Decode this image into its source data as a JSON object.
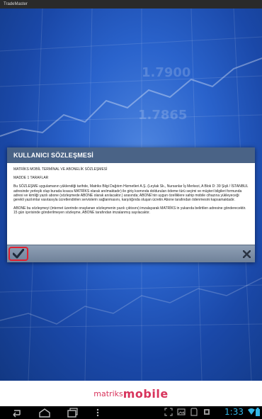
{
  "app": {
    "title": "TradeMaster"
  },
  "background": {
    "numbers": [
      "1.7900",
      "1.7865"
    ]
  },
  "dialog": {
    "title": "KULLANICI SÖZLEŞMESİ",
    "heading": "MATRİKS MOBİL TERMİNAL VE ABONELİK SÖZLEŞMESİ",
    "section": "MADDE 1 TARAFLAR",
    "paragraph1": "Bu SÖZLEŞME uygulamanın yüklendiği tarihde, Matriks Bilgi Dağıtım Hizmetleri A.Ş. (Leylak Sk., Nursanlar İş Merkezi, A Blok D: 39 Şişli / İSTANBUL adresinde yerleşik olup burada kısaca MATRİKS olarak anılmaktadır) ile giriş kısmında doldurulan ödeme türü seçimi ve müşteri bilgileri formunda adresi ve kimliği yazılı abone (sözleşmede ABONE olarak anılacaktır.) arasında; ABONE'nin uygun özelliklere sahip mobile cihazına yükleyeceği gerekli yazılımlar vasıtasıyla ücretlendirilen servislerin sağlanmasını, karşılığında oluşan ücretin Abone tarafından ödenmesini kapsamaktadır.",
    "paragraph2": "ABONE bu sözleşmeyi (internet üzerinde onaylanan sözleşmenin yazılı çıktısını) imzalayarak MATRİKS in yukarıda belirtilen adresine gönderecektir. 15 gün içerisinde gönderilmeyen sözleşme, ABONE tarafından imzalanmış sayılacaktır."
  },
  "brand": {
    "part1": "matriks",
    "part2": "mobile"
  },
  "statusbar": {
    "time": "1:33"
  },
  "colors": {
    "accent": "#33b5e5",
    "brand": "#d8345c",
    "dialog_header": "#4a6386",
    "highlight": "#e02030"
  }
}
